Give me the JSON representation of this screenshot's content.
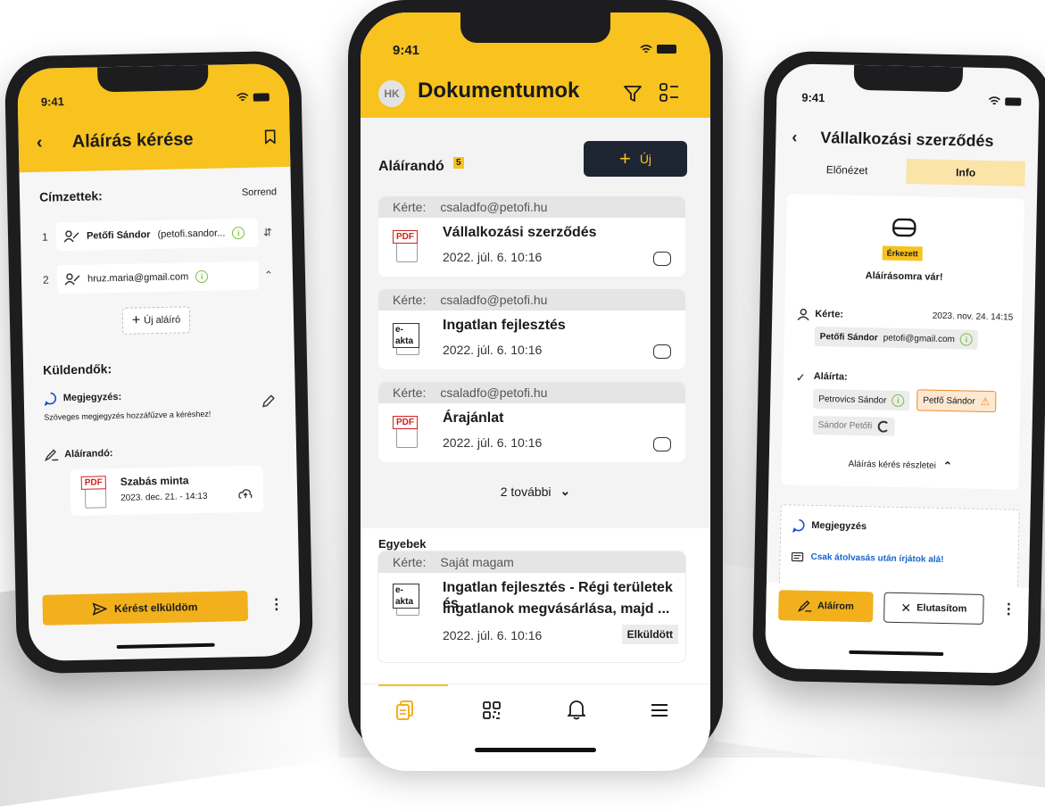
{
  "status_time": "9:41",
  "left": {
    "header_title": "Aláírás kérése",
    "recipients_label": "Címzettek:",
    "order_label": "Sorrend",
    "recipients": [
      {
        "num": "1",
        "name": "Petőfi Sándor",
        "email": "(petofi.sandor..."
      },
      {
        "num": "2",
        "name": "",
        "email": "hruz.maria@gmail.com"
      }
    ],
    "add_signer_label": "Új aláíró",
    "senders_label": "Küldendők:",
    "note_label": "Megjegyzés:",
    "note_text": "Szöveges megjegyzés hozzáfűzve a kéréshez!",
    "to_sign_label": "Aláírandó:",
    "doc": {
      "tag": "PDF",
      "title": "Szabás minta",
      "date": "2023. dec. 21. - 14:13"
    },
    "send_button": "Kérést elküldöm"
  },
  "center": {
    "avatar": "HK",
    "header_title": "Dokumentumok",
    "section_to_sign": "Aláírandó",
    "count_badge": "5",
    "new_button": "Új",
    "requester_label": "Kérte:",
    "requests": [
      {
        "requester": "csaladfo@petofi.hu",
        "tag": "PDF",
        "title": "Vállalkozási szerződés",
        "date": "2022. júl. 6. 10:16"
      },
      {
        "requester": "csaladfo@petofi.hu",
        "tag": "e-akta",
        "title": "Ingatlan fejlesztés",
        "date": "2022. júl. 6. 10:16"
      },
      {
        "requester": "csaladfo@petofi.hu",
        "tag": "PDF",
        "title": "Árajánlat",
        "date": "2022. júl. 6. 10:16"
      }
    ],
    "more_label": "2 további",
    "section_other": "Egyebek",
    "other_request": {
      "requester": "Saját magam",
      "tag": "e-akta",
      "title_line1": "Ingatlan fejlesztés - Régi területek és",
      "title_line2": "ingatlanok megvásárlása, majd ...",
      "date": "2022. júl. 6. 10:16",
      "status": "Elküldött"
    }
  },
  "right": {
    "header_title": "Vállalkozási szerződés",
    "tab_preview": "Előnézet",
    "tab_info": "Info",
    "status_badge": "Érkezett",
    "status_text": "Aláírásomra vár!",
    "requested_label": "Kérte:",
    "requested_date": "2023. nov. 24. 14:15",
    "requested_name": "Petőfi Sándor",
    "requested_email": "petofi@gmail.com",
    "signed_label": "Aláírta:",
    "signers": [
      "Petrovics Sándor",
      "Petfő Sándor",
      "Sándor Petőfi"
    ],
    "details_label": "Aláírás kérés részletei",
    "note_label": "Megjegyzés",
    "note_text": "Csak átolvasás után írjátok alá!",
    "sign_button": "Aláírom",
    "reject_button": "Elutasítom"
  }
}
